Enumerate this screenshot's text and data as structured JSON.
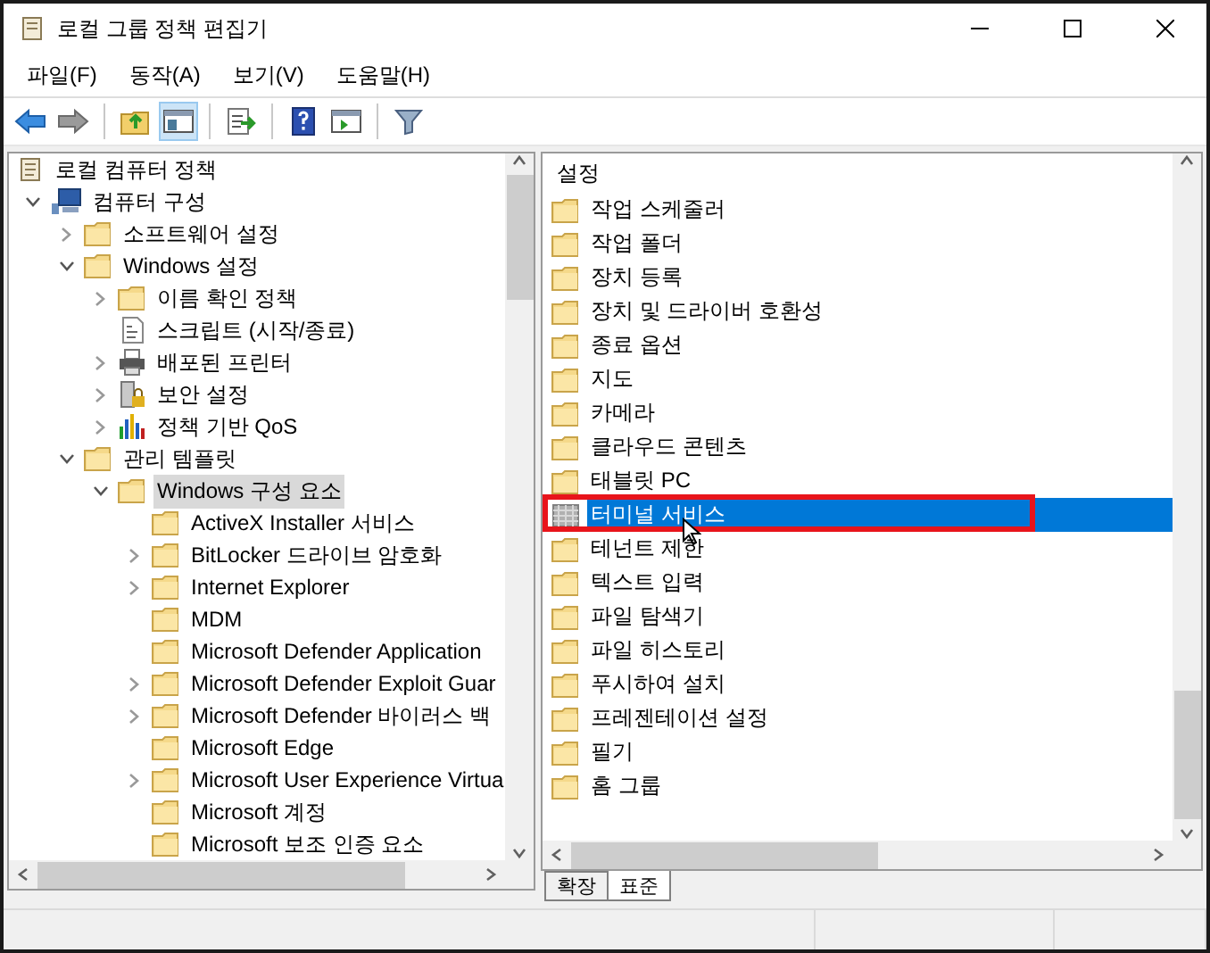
{
  "window": {
    "title": "로컬 그룹 정책 편집기"
  },
  "menu": [
    "파일(F)",
    "동작(A)",
    "보기(V)",
    "도움말(H)"
  ],
  "toolbar": [
    {
      "kind": "back",
      "pressed": false
    },
    {
      "kind": "forward",
      "pressed": false
    },
    {
      "kind": "sep"
    },
    {
      "kind": "up",
      "pressed": false
    },
    {
      "kind": "tree",
      "pressed": true
    },
    {
      "kind": "sep"
    },
    {
      "kind": "export",
      "pressed": false
    },
    {
      "kind": "sep"
    },
    {
      "kind": "help",
      "pressed": false
    },
    {
      "kind": "pane",
      "pressed": false
    },
    {
      "kind": "sep"
    },
    {
      "kind": "filter",
      "pressed": false
    }
  ],
  "tree": [
    {
      "label": "로컬 컴퓨터 정책",
      "kind": "root",
      "selected": false,
      "children": [
        {
          "label": "컴퓨터 구성",
          "kind": "computer",
          "expanded": true,
          "selected": false,
          "children": [
            {
              "label": "소프트웨어 설정",
              "kind": "folder",
              "expanded": false,
              "selected": false
            },
            {
              "label": "Windows 설정",
              "kind": "folder",
              "expanded": true,
              "selected": false,
              "children": [
                {
                  "label": "이름 확인 정책",
                  "kind": "folder",
                  "expanded": false,
                  "selected": false
                },
                {
                  "label": "스크립트 (시작/종료)",
                  "kind": "script",
                  "selected": false
                },
                {
                  "label": "배포된 프린터",
                  "kind": "printer",
                  "expanded": false,
                  "selected": false
                },
                {
                  "label": "보안 설정",
                  "kind": "security",
                  "expanded": false,
                  "selected": false
                },
                {
                  "label": "정책 기반 QoS",
                  "kind": "chart",
                  "expanded": false,
                  "selected": false
                }
              ]
            },
            {
              "label": "관리 템플릿",
              "kind": "folder",
              "expanded": true,
              "selected": false,
              "children": [
                {
                  "label": "Windows 구성 요소",
                  "kind": "folder",
                  "expanded": true,
                  "selected": true,
                  "children": [
                    {
                      "label": "ActiveX Installer 서비스",
                      "kind": "folder",
                      "selected": false
                    },
                    {
                      "label": "BitLocker 드라이브 암호화",
                      "kind": "folder",
                      "expanded": false,
                      "selected": false
                    },
                    {
                      "label": "Internet Explorer",
                      "kind": "folder",
                      "expanded": false,
                      "selected": false
                    },
                    {
                      "label": "MDM",
                      "kind": "folder",
                      "selected": false
                    },
                    {
                      "label": "Microsoft Defender Application",
                      "kind": "folder",
                      "selected": false
                    },
                    {
                      "label": "Microsoft Defender Exploit Guar",
                      "kind": "folder",
                      "expanded": false,
                      "selected": false
                    },
                    {
                      "label": "Microsoft Defender 바이러스 백",
                      "kind": "folder",
                      "expanded": false,
                      "selected": false
                    },
                    {
                      "label": "Microsoft Edge",
                      "kind": "folder",
                      "selected": false
                    },
                    {
                      "label": "Microsoft User Experience Virtua",
                      "kind": "folder",
                      "expanded": false,
                      "selected": false
                    },
                    {
                      "label": "Microsoft 계정",
                      "kind": "folder",
                      "selected": false
                    },
                    {
                      "label": "Microsoft 보조 인증 요소",
                      "kind": "folder",
                      "selected": false
                    }
                  ]
                }
              ]
            }
          ]
        }
      ]
    }
  ],
  "list": {
    "header": "설정",
    "items": [
      {
        "label": "작업 스케줄러",
        "kind": "folder",
        "selected": false,
        "highlighted": false
      },
      {
        "label": "작업 폴더",
        "kind": "folder",
        "selected": false,
        "highlighted": false
      },
      {
        "label": "장치 등록",
        "kind": "folder",
        "selected": false,
        "highlighted": false
      },
      {
        "label": "장치 및 드라이버 호환성",
        "kind": "folder",
        "selected": false,
        "highlighted": false
      },
      {
        "label": "종료 옵션",
        "kind": "folder",
        "selected": false,
        "highlighted": false
      },
      {
        "label": "지도",
        "kind": "folder",
        "selected": false,
        "highlighted": false
      },
      {
        "label": "카메라",
        "kind": "folder",
        "selected": false,
        "highlighted": false
      },
      {
        "label": "클라우드 콘텐츠",
        "kind": "folder",
        "selected": false,
        "highlighted": false
      },
      {
        "label": "태블릿 PC",
        "kind": "folder",
        "selected": false,
        "highlighted": false
      },
      {
        "label": "터미널 서비스",
        "kind": "setting",
        "selected": true,
        "highlighted": true
      },
      {
        "label": "테넌트 제한",
        "kind": "folder",
        "selected": false,
        "highlighted": false
      },
      {
        "label": "텍스트 입력",
        "kind": "folder",
        "selected": false,
        "highlighted": false
      },
      {
        "label": "파일 탐색기",
        "kind": "folder",
        "selected": false,
        "highlighted": false
      },
      {
        "label": "파일 히스토리",
        "kind": "folder",
        "selected": false,
        "highlighted": false
      },
      {
        "label": "푸시하여 설치",
        "kind": "folder",
        "selected": false,
        "highlighted": false
      },
      {
        "label": "프레젠테이션 설정",
        "kind": "folder",
        "selected": false,
        "highlighted": false
      },
      {
        "label": "필기",
        "kind": "folder",
        "selected": false,
        "highlighted": false
      },
      {
        "label": "홈 그룹",
        "kind": "folder",
        "selected": false,
        "highlighted": false
      }
    ]
  },
  "view_tabs": [
    {
      "label": "확장",
      "selected": false
    },
    {
      "label": "표준",
      "selected": true
    }
  ]
}
